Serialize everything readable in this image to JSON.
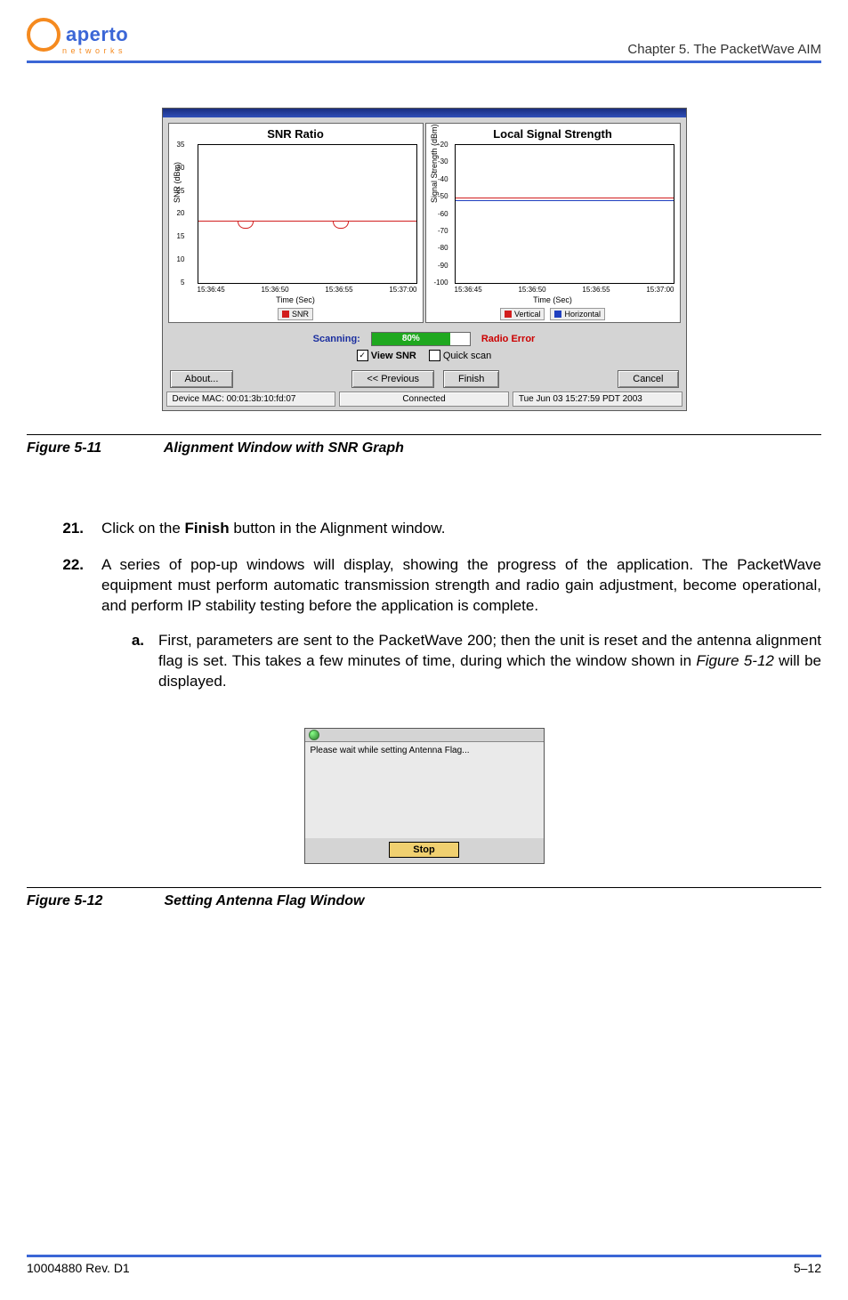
{
  "header": {
    "logo_main": "aperto",
    "logo_sub": "n e t w o r k s",
    "chapter": "Chapter 5.  The PacketWave AIM"
  },
  "fig1": {
    "snr_title": "SNR Ratio",
    "snr_ylabel": "SNR (dBm)",
    "snr_xlabel": "Time (Sec)",
    "snr_yticks": [
      "35",
      "30",
      "25",
      "20",
      "15",
      "10",
      "5"
    ],
    "snr_xticks": [
      "15:36:45",
      "15:36:50",
      "15:36:55",
      "15:37:00"
    ],
    "snr_legend": "SNR",
    "lss_title": "Local Signal Strength",
    "lss_ylabel": "Signal Strength (dBm)",
    "lss_xlabel": "Time (Sec)",
    "lss_yticks": [
      "-20",
      "-30",
      "-40",
      "-50",
      "-60",
      "-70",
      "-80",
      "-90",
      "-100"
    ],
    "lss_xticks": [
      "15:36:45",
      "15:36:50",
      "15:36:55",
      "15:37:00"
    ],
    "lss_legend_v": "Vertical",
    "lss_legend_h": "Horizontal",
    "scanning_label": "Scanning:",
    "scan_pct": "80%",
    "radio_error": "Radio Error",
    "view_snr": "View SNR",
    "quick_scan": "Quick scan",
    "btn_about": "About...",
    "btn_prev": "<< Previous",
    "btn_finish": "Finish",
    "btn_cancel": "Cancel",
    "status_mac": "Device MAC: 00:01:3b:10:fd:07",
    "status_conn": "Connected",
    "status_time": "Tue Jun 03 15:27:59 PDT 2003",
    "caption_num": "Figure 5-11",
    "caption_txt": "Alignment Window with SNR Graph"
  },
  "chart_data": [
    {
      "type": "line",
      "title": "SNR Ratio",
      "xlabel": "Time (Sec)",
      "ylabel": "SNR (dBm)",
      "ylim": [
        5,
        35
      ],
      "x": [
        "15:36:45",
        "15:36:50",
        "15:36:55",
        "15:37:00"
      ],
      "series": [
        {
          "name": "SNR",
          "values": [
            17,
            17,
            16,
            17,
            17,
            17,
            17,
            16,
            17,
            17
          ]
        }
      ]
    },
    {
      "type": "line",
      "title": "Local Signal Strength",
      "xlabel": "Time (Sec)",
      "ylabel": "Signal Strength (dBm)",
      "ylim": [
        -100,
        -20
      ],
      "x": [
        "15:36:45",
        "15:36:50",
        "15:36:55",
        "15:37:00"
      ],
      "series": [
        {
          "name": "Vertical",
          "values": [
            -50,
            -50,
            -50,
            -50
          ]
        },
        {
          "name": "Horizontal",
          "values": [
            -50,
            -50,
            -50,
            -50
          ]
        }
      ]
    }
  ],
  "steps": {
    "s21_num": "21.",
    "s21_a": "Click on the ",
    "s21_bold": "Finish",
    "s21_b": " button in the Alignment window.",
    "s22_num": "22.",
    "s22": "A series of pop-up windows will display, showing the progress of the application. The PacketWave equipment must perform automatic transmission strength and radio gain adjustment, become operational, and perform IP stability testing before the application is complete.",
    "s22a_num": "a.",
    "s22a_a": "First, parameters are sent to the PacketWave 200; then the unit is reset and the antenna alignment flag is set. This takes a few minutes of time, during which the window shown in ",
    "s22a_i": "Figure 5-12",
    "s22a_b": " will be displayed."
  },
  "fig2": {
    "msg": "Please wait while setting Antenna Flag...",
    "btn_stop": "Stop",
    "caption_num": "Figure 5-12",
    "caption_txt": "Setting Antenna Flag Window"
  },
  "footer": {
    "left": "10004880 Rev. D1",
    "right": "5–12"
  }
}
